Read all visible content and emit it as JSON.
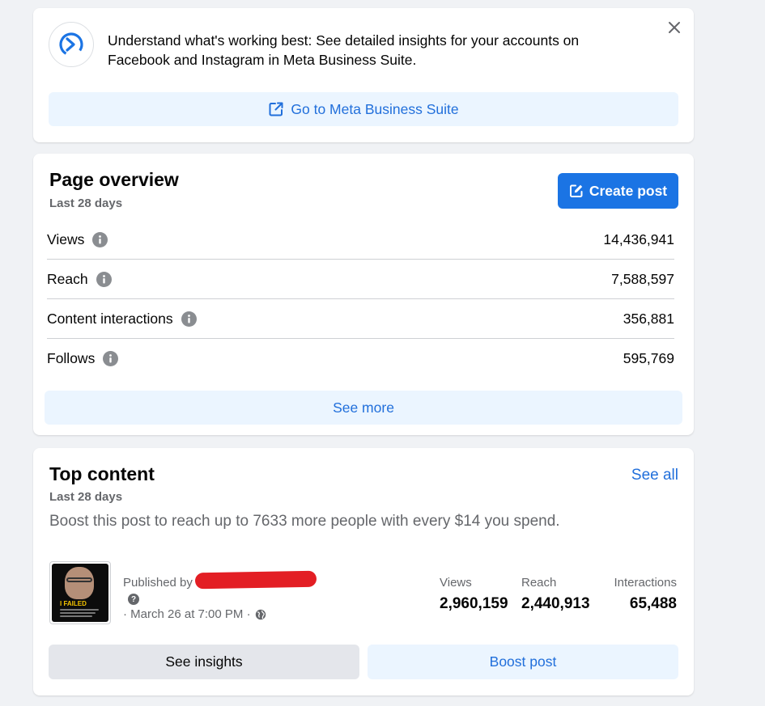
{
  "banner": {
    "message": "Understand what's working best: See detailed insights for your accounts on Facebook and Instagram in Meta Business Suite.",
    "button_label": "Go to Meta Business Suite",
    "logo_icon": "meta-business-suite-logo",
    "close_icon": "close-icon"
  },
  "overview": {
    "title": "Page overview",
    "subtitle": "Last 28 days",
    "create_post_label": "Create post",
    "metrics": [
      {
        "label": "Views",
        "value": "14,436,941"
      },
      {
        "label": "Reach",
        "value": "7,588,597"
      },
      {
        "label": "Content interactions",
        "value": "356,881"
      },
      {
        "label": "Follows",
        "value": "595,769"
      }
    ],
    "see_more_label": "See more"
  },
  "top_content": {
    "title": "Top content",
    "subtitle": "Last 28 days",
    "see_all_label": "See all",
    "boost_message": "Boost this post to reach up to 7633 more people with every $14 you spend.",
    "post": {
      "published_prefix": "Published by",
      "question_mark": "?",
      "date": "· March 26 at 7:00 PM ·",
      "thumbnail_text": "I FAILED",
      "stats": [
        {
          "label": "Views",
          "value": "2,960,159"
        },
        {
          "label": "Reach",
          "value": "2,440,913"
        },
        {
          "label": "Interactions",
          "value": "65,488"
        }
      ]
    },
    "see_insights_label": "See insights",
    "boost_post_label": "Boost post"
  },
  "colors": {
    "accent": "#1b74e4",
    "link": "#216fdb",
    "light_blue_bg": "#ebf5ff",
    "gray_button": "#e4e6eb",
    "page_bg": "#f0f2f5",
    "redaction": "#e31e24"
  }
}
